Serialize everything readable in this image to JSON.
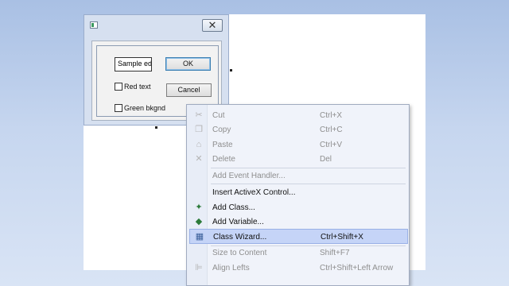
{
  "dialog": {
    "close_glyph": "✕",
    "edit_value": "Sample ed",
    "ok_label": "OK",
    "cancel_label": "Cancel",
    "check_red_label": "Red text",
    "check_green_label": "Green bkgnd"
  },
  "menu": {
    "items": [
      {
        "label": "Cut",
        "shortcut": "Ctrl+X",
        "icon": "cut-icon",
        "enabled": false
      },
      {
        "label": "Copy",
        "shortcut": "Ctrl+C",
        "icon": "copy-icon",
        "enabled": false
      },
      {
        "label": "Paste",
        "shortcut": "Ctrl+V",
        "icon": "paste-icon",
        "enabled": false
      },
      {
        "label": "Delete",
        "shortcut": "Del",
        "icon": "delete-icon",
        "enabled": false
      },
      {
        "label": "Add Event Handler...",
        "shortcut": "",
        "icon": "",
        "enabled": false
      },
      {
        "label": "Insert ActiveX Control...",
        "shortcut": "",
        "icon": "",
        "enabled": true
      },
      {
        "label": "Add Class...",
        "shortcut": "",
        "icon": "add-class-icon",
        "enabled": true
      },
      {
        "label": "Add Variable...",
        "shortcut": "",
        "icon": "add-variable-icon",
        "enabled": true
      },
      {
        "label": "Class Wizard...",
        "shortcut": "Ctrl+Shift+X",
        "icon": "class-wizard-icon",
        "enabled": true,
        "selected": true
      },
      {
        "label": "Size to Content",
        "shortcut": "Shift+F7",
        "icon": "",
        "enabled": false
      },
      {
        "label": "Align Lefts",
        "shortcut": "Ctrl+Shift+Left Arrow",
        "icon": "align-lefts-icon",
        "enabled": false
      }
    ]
  },
  "colors": {
    "background": "#b7cbeb",
    "menu_highlight": "#c5d4f7",
    "disabled_text": "#8e8e8e"
  }
}
